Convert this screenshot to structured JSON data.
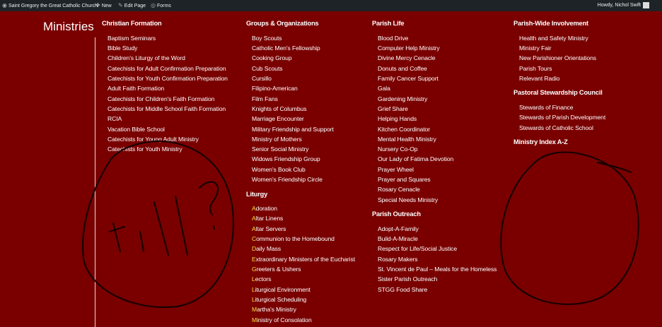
{
  "admin_bar": {
    "site_name": "Saint Gregory the Great Catholic Church",
    "new_label": "New",
    "edit_label": "Edit Page",
    "forms_label": "Forms",
    "greeting": "Howdy, Nichol Swift"
  },
  "page": {
    "title": "Ministries"
  },
  "columns": [
    {
      "sections": [
        {
          "heading": "Christian Formation",
          "items": [
            "Baptism Seminars",
            "Bible Study",
            "Children's Liturgy of the Word",
            "Catechists for Adult Confirmation Preparation",
            "Catechists for Youth Confirmation Preparation",
            "Adult Faith Formation",
            "Catechists for Children's Faith Formation",
            "Catechists for Middle School Faith Formation",
            "RCIA",
            "Vacation Bible School",
            "Catechists for Young Adult Ministry",
            "Catechists for Youth Ministry"
          ]
        }
      ]
    },
    {
      "sections": [
        {
          "heading": "Groups & Organizations",
          "items": [
            "Boy Scouts",
            "Catholic Men's Fellowship",
            "Cooking Group",
            "Cub Scouts",
            "Cursillo",
            "Filipino-American",
            "Film Fans",
            "Knights of Columbus",
            "Marriage Encounter",
            "Military Friendship and Support",
            "Ministry of Mothers",
            "Senior Social Ministry",
            "Widows Friendship Group",
            "Women's Book Club",
            "Women's Friendship Circle"
          ]
        },
        {
          "heading": "Liturgy",
          "items": [
            "Adoration",
            "Altar Linens",
            "Altar Servers",
            "Communion to the Homebound",
            "Daily Mass",
            "Extraordinary Ministers of the Eucharist",
            "Greeters & Ushers",
            "Lectors",
            "Liturgical Environment",
            "Liturgical Scheduling",
            "Martha's Ministry",
            "Ministry of Consolation"
          ]
        }
      ]
    },
    {
      "sections": [
        {
          "heading": "Parish Life",
          "items": [
            "Blood Drive",
            "Computer Help Ministry",
            "Divine Mercy Cenacle",
            "Donuts and Coffee",
            "Family Cancer Support",
            "Gala",
            "Gardening Ministry",
            "Grief Share",
            "Helping Hands",
            "Kitchen Coordinator",
            "Mental Health Ministry",
            "Nursery Co-Op",
            "Our Lady of Fatima Devotion",
            "Prayer Wheel",
            "Prayer and Squares",
            "Rosary Cenacle",
            "Special Needs Ministry"
          ]
        },
        {
          "heading": "Parish Outreach",
          "items": [
            "Adopt-A-Family",
            "Build-A-Miracle",
            "Respect for Life/Social Justice",
            "Rosary Makers",
            "St. Vincent de Paul – Meals for the Homeless",
            "Sister Parish Outreach",
            "STGG Food Share"
          ]
        }
      ]
    },
    {
      "sections": [
        {
          "heading": "Parish-Wide Involvement",
          "items": [
            "Health and Safety Ministry",
            "Ministry Fair",
            "New Parishioner Orientations",
            "Parish Tours",
            "Relevant Radio"
          ]
        },
        {
          "heading": "Pastoral Stewardship Council",
          "items": [
            "Stewards of Finance",
            "Stewards of Parish Development",
            "Stewards of Catholic School"
          ]
        },
        {
          "heading": "Ministry Index A-Z",
          "items": []
        }
      ]
    }
  ],
  "annotation": {
    "handwritten_text": "Fill?"
  },
  "colors": {
    "background": "#7a0000",
    "admin_bar": "#1d2327",
    "highlight": "#f3e23a"
  }
}
